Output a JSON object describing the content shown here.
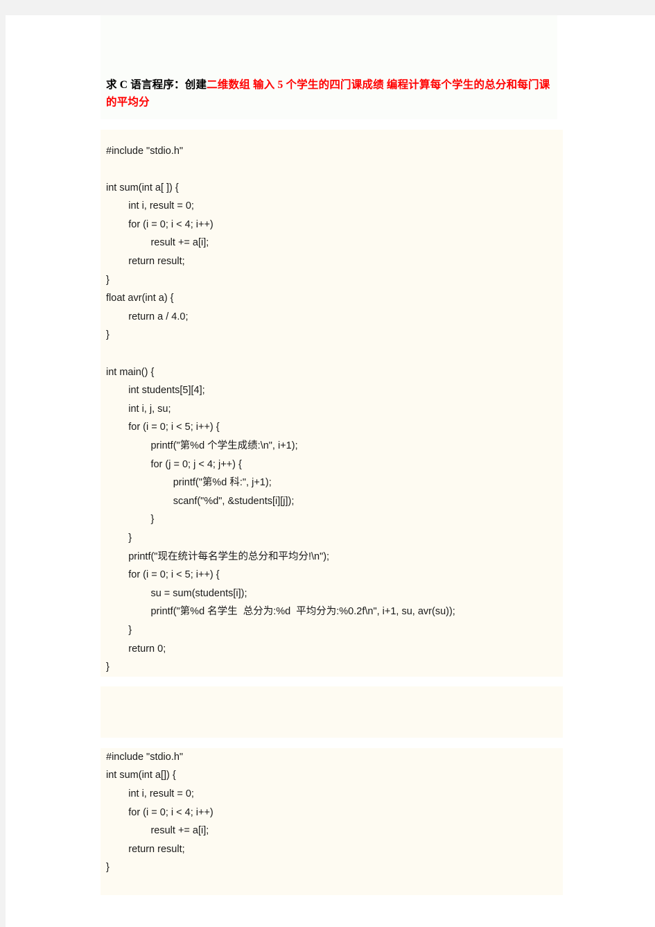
{
  "page": {
    "background_color": "#f2f2f2",
    "sheet_color": "#ffffff",
    "title_band_color": "#fbfdfa",
    "code_band_color": "#fefbf2"
  },
  "title": {
    "black_part": "求 C 语言程序：创建",
    "red_part": "二维数组 输入 5 个学生的四门课成绩 编程计算每个学生的总分和每门课的平均分",
    "red_color": "#ff0000",
    "black_color": "#000000"
  },
  "code_blocks": [
    {
      "id": "code-block-1",
      "lines": [
        "#include \"stdio.h\"",
        "",
        "int sum(int a[ ]) {",
        "        int i, result = 0;",
        "        for (i = 0; i < 4; i++)",
        "                result += a[i];",
        "        return result;",
        "}",
        "float avr(int a) {",
        "        return a / 4.0;",
        "}",
        "",
        "int main() {",
        "        int students[5][4];",
        "        int i, j, su;",
        "        for (i = 0; i < 5; i++) {",
        "                printf(\"第%d 个学生成绩:\\n\", i+1);",
        "                for (j = 0; j < 4; j++) {",
        "                        printf(\"第%d 科:\", j+1);",
        "                        scanf(\"%d\", &students[i][j]);",
        "                }",
        "        }",
        "        printf(\"现在统计每名学生的总分和平均分!\\n\");",
        "        for (i = 0; i < 5; i++) {",
        "                su = sum(students[i]);",
        "                printf(\"第%d 名学生  总分为:%d  平均分为:%0.2f\\n\", i+1, su, avr(su));",
        "        }",
        "        return 0;",
        "}"
      ]
    },
    {
      "id": "code-block-2",
      "lines": [
        "#include \"stdio.h\"",
        "int sum(int a[]) {",
        "        int i, result = 0;",
        "        for (i = 0; i < 4; i++)",
        "                result += a[i];",
        "        return result;",
        "}"
      ]
    }
  ]
}
